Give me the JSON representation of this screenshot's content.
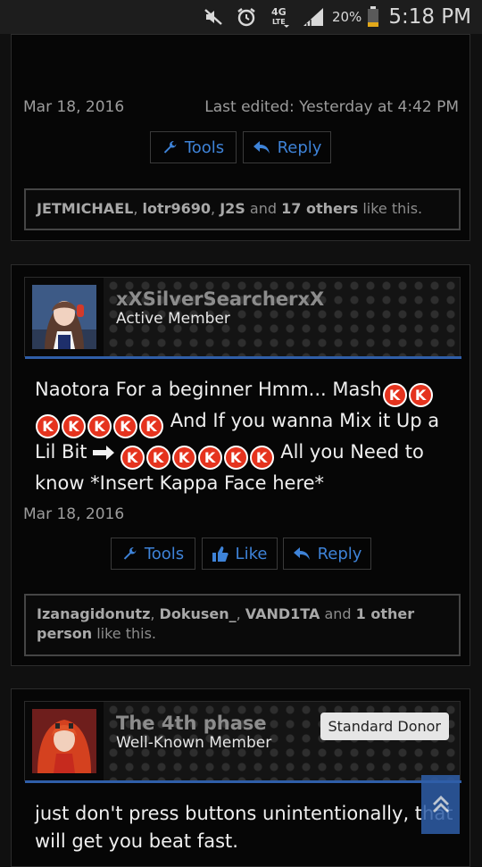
{
  "status_bar": {
    "battery": "20%",
    "time": "5:18 PM",
    "network_badge": "4G LTE",
    "icons": [
      "mute-icon",
      "alarm-icon",
      "network-4g-icon",
      "signal-icon",
      "battery-icon"
    ]
  },
  "colors": {
    "accent": "#3e83d8",
    "rule": "#2f5ea8",
    "k_button": "#e5331e"
  },
  "posts": [
    {
      "date": "Mar 18, 2016",
      "last_edited": "Last edited: Yesterday at 4:42 PM",
      "buttons": {
        "tools": "Tools",
        "reply": "Reply"
      },
      "likes": {
        "names": [
          "JETMICHAEL",
          "lotr9690",
          "J2S"
        ],
        "and": "and",
        "others": "17 others",
        "suffix": "like this."
      }
    },
    {
      "user": {
        "name": "xXSilverSearcherxX",
        "title": "Active Member",
        "avatar": "avatar-anime-girl"
      },
      "message": {
        "k_label": "K",
        "part1": "Naotora For a beginner Hmm... Mash",
        "part2": "And If you wanna Mix it Up a Lil Bit",
        "part3": "All you Need to know *Insert Kappa Face here*"
      },
      "date": "Mar 18, 2016",
      "buttons": {
        "tools": "Tools",
        "like": "Like",
        "reply": "Reply"
      },
      "likes": {
        "names": [
          "Izanagidonutz",
          "Dokusen_",
          "VAND1TA"
        ],
        "and": "and",
        "others": "1 other person",
        "suffix": "like this."
      }
    },
    {
      "user": {
        "name": "The 4th phase",
        "title": "Well-Known Member",
        "badge": "Standard Donor",
        "avatar": "avatar-red-hair"
      },
      "message": {
        "text": "just don't press buttons unintentionally, that will get you beat fast."
      }
    }
  ]
}
